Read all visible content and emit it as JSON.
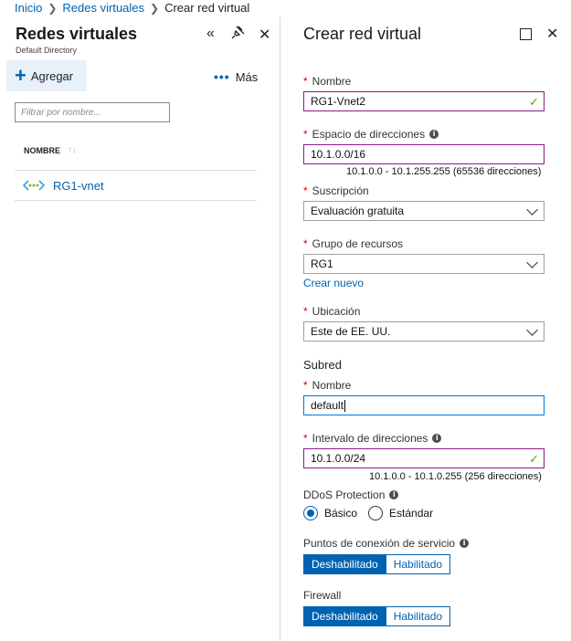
{
  "breadcrumb": {
    "items": [
      "Inicio",
      "Redes virtuales",
      "Crear red virtual"
    ]
  },
  "left_blade": {
    "title": "Redes virtuales",
    "subtitle": "Default Directory",
    "add_label": "Agregar",
    "more_label": "Más",
    "filter_placeholder": "Filtrar por nombre...",
    "column_header": "NOMBRE",
    "rows": [
      {
        "name": "RG1-vnet"
      }
    ]
  },
  "right_blade": {
    "title": "Crear red virtual",
    "name": {
      "label": "Nombre",
      "value": "RG1-Vnet2"
    },
    "address_space": {
      "label": "Espacio de direcciones",
      "value": "10.1.0.0/16",
      "hint": "10.1.0.0 - 10.1.255.255 (65536 direcciones)"
    },
    "subscription": {
      "label": "Suscripción",
      "value": "Evaluación gratuita"
    },
    "resource_group": {
      "label": "Grupo de recursos",
      "value": "RG1",
      "create_new": "Crear nuevo"
    },
    "location": {
      "label": "Ubicación",
      "value": "Este de EE. UU."
    },
    "subnet": {
      "section": "Subred",
      "name": {
        "label": "Nombre",
        "value": "default"
      },
      "address_range": {
        "label": "Intervalo de direcciones",
        "value": "10.1.0.0/24",
        "hint": "10.1.0.0 - 10.1.0.255 (256 direcciones)"
      }
    },
    "ddos": {
      "label": "DDoS Protection",
      "options": [
        "Básico",
        "Estándar"
      ],
      "selected": "Básico"
    },
    "service_endpoints": {
      "label": "Puntos de conexión de servicio",
      "options": [
        "Deshabilitado",
        "Habilitado"
      ],
      "selected": "Deshabilitado"
    },
    "firewall": {
      "label": "Firewall",
      "options": [
        "Deshabilitado",
        "Habilitado"
      ],
      "selected": "Deshabilitado"
    }
  },
  "colors": {
    "accent": "#0063b1",
    "valid_check": "#57a300",
    "required": "#d00000"
  }
}
